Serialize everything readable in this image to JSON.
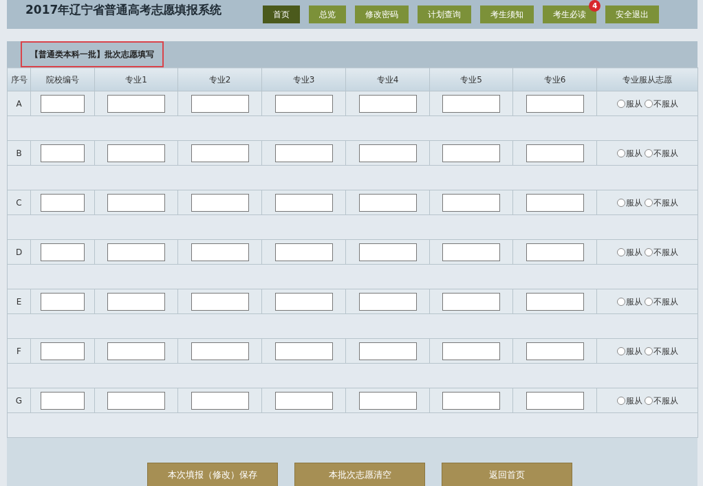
{
  "header": {
    "title": "2017年辽宁省普通高考志愿填报系统"
  },
  "nav": [
    {
      "label": "首页",
      "selected": true
    },
    {
      "label": "总览",
      "selected": false
    },
    {
      "label": "修改密码",
      "selected": false
    },
    {
      "label": "计划查询",
      "selected": false
    },
    {
      "label": "考生须知",
      "selected": false
    },
    {
      "label": "考生必读",
      "selected": false,
      "badge": "4"
    },
    {
      "label": "安全退出",
      "selected": false
    }
  ],
  "section": {
    "title": "【普通类本科一批】批次志愿填写",
    "highlighted": true
  },
  "table": {
    "columns": [
      "序号",
      "院校编号",
      "专业1",
      "专业2",
      "专业3",
      "专业4",
      "专业5",
      "专业6",
      "专业服从志愿"
    ],
    "rows": [
      {
        "label": "A",
        "options": [
          {
            "label": "服从",
            "selected": false
          },
          {
            "label": "不服从",
            "selected": false
          }
        ]
      },
      {
        "label": "B",
        "options": [
          {
            "label": "服从",
            "selected": false
          },
          {
            "label": "不服从",
            "selected": false
          }
        ]
      },
      {
        "label": "C",
        "options": [
          {
            "label": "服从",
            "selected": false
          },
          {
            "label": "不服从",
            "selected": false
          }
        ]
      },
      {
        "label": "D",
        "options": [
          {
            "label": "服从",
            "selected": false
          },
          {
            "label": "不服从",
            "selected": false
          }
        ]
      },
      {
        "label": "E",
        "options": [
          {
            "label": "服从",
            "selected": false
          },
          {
            "label": "不服从",
            "selected": false
          }
        ]
      },
      {
        "label": "F",
        "options": [
          {
            "label": "服从",
            "selected": false
          },
          {
            "label": "不服从",
            "selected": false
          }
        ]
      },
      {
        "label": "G",
        "options": [
          {
            "label": "服从",
            "selected": false
          },
          {
            "label": "不服从",
            "selected": false
          }
        ]
      }
    ]
  },
  "actions": [
    "本次填报（修改）保存",
    "本批次志愿清空",
    "返回首页"
  ]
}
